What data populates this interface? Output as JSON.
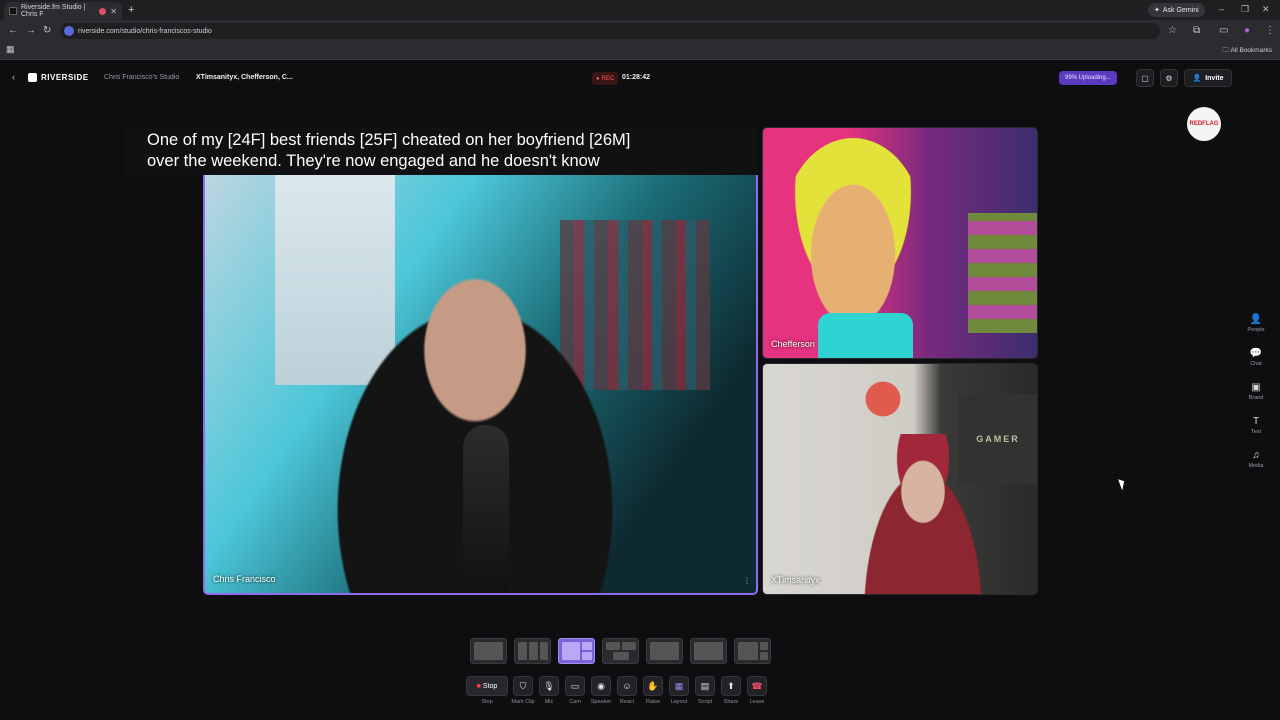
{
  "browser": {
    "tab_title": "Riverside.fm Studio | Chris F",
    "new_tab": "+",
    "ask_gemini": "Ask Gemini",
    "url": "riverside.com/studio/chris-franciscos-studio",
    "all_bookmarks": "All Bookmarks",
    "minimize": "–",
    "restore": "❐",
    "close": "✕"
  },
  "header": {
    "back": "‹",
    "logo": "RIVERSIDE",
    "studio": "Chris Francisco's Studio",
    "session": "XTimsanityx, Chefferson, C...",
    "rec_label": "REC",
    "timer": "01:28:42",
    "upload": "99% Uploading...",
    "invite": "Invite",
    "overlay_logo": "REDFLAG"
  },
  "caption": "One of my [24F] best friends [25F] cheated on her boyfriend [26M]\nover the weekend. They're now engaged and he doesn't know",
  "tiles": {
    "main": "Chris Francisco",
    "cartoon": "Chefferson",
    "cam": "XTimsanityx",
    "cam_poster": "GAMER"
  },
  "controls": [
    {
      "name": "stop-button",
      "icon": "■",
      "label": "Stop",
      "btn_text": "Stop"
    },
    {
      "name": "mark-clip-button",
      "icon": "⛉",
      "label": "Mark Clip"
    },
    {
      "name": "mic-button",
      "icon": "🎙",
      "label": "Mic"
    },
    {
      "name": "cam-button",
      "icon": "▭",
      "label": "Cam"
    },
    {
      "name": "speaker-button",
      "icon": "◉",
      "label": "Speaker"
    },
    {
      "name": "react-button",
      "icon": "☺",
      "label": "React"
    },
    {
      "name": "raise-button",
      "icon": "✋",
      "label": "Raise"
    },
    {
      "name": "layout-button",
      "icon": "▦",
      "label": "Layout"
    },
    {
      "name": "script-button",
      "icon": "▤",
      "label": "Script"
    },
    {
      "name": "share-button",
      "icon": "⬆",
      "label": "Share"
    },
    {
      "name": "leave-button",
      "icon": "☎",
      "label": "Leave"
    }
  ],
  "side_panel": [
    {
      "name": "people",
      "icon": "👤",
      "label": "People"
    },
    {
      "name": "chat",
      "icon": "💬",
      "label": "Chat"
    },
    {
      "name": "brand",
      "icon": "▣",
      "label": "Brand"
    },
    {
      "name": "text",
      "icon": "T",
      "label": "Text"
    },
    {
      "name": "media",
      "icon": "♫",
      "label": "Media"
    }
  ],
  "colors": {
    "accent": "#7b62d9",
    "rec": "#ff5a5a",
    "upload": "#5a3bbf"
  }
}
